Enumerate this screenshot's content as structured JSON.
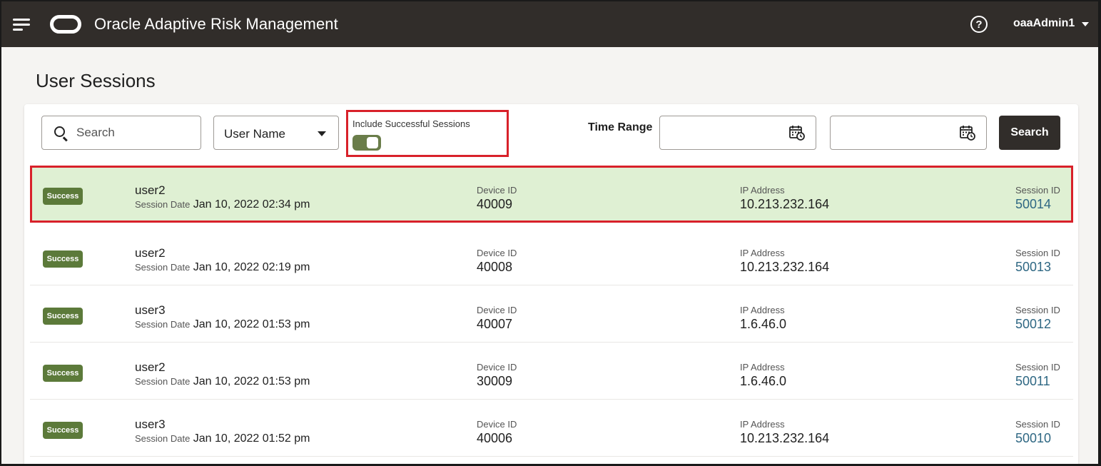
{
  "header": {
    "app_title": "Oracle Adaptive Risk Management",
    "user": "oaaAdmin1",
    "icons": [
      "hamburger-menu-icon",
      "oracle-logo",
      "help-icon",
      "caret-down-icon"
    ]
  },
  "page": {
    "title": "User Sessions"
  },
  "filters": {
    "search_placeholder": "Search",
    "search_value": "",
    "field_select": "User Name",
    "toggle_label": "Include Successful Sessions",
    "toggle_on": true,
    "time_range_label": "Time Range",
    "from_date": "",
    "to_date": "",
    "search_button": "Search"
  },
  "columns": {
    "session_date": "Session Date",
    "device_id": "Device ID",
    "ip_address": "IP Address",
    "session_id": "Session ID"
  },
  "sessions": [
    {
      "status": "Success",
      "user": "user2",
      "date": "Jan 10, 2022 02:34 pm",
      "device_id": "40009",
      "ip": "10.213.232.164",
      "session_id": "50014"
    },
    {
      "status": "Success",
      "user": "user2",
      "date": "Jan 10, 2022 02:19 pm",
      "device_id": "40008",
      "ip": "10.213.232.164",
      "session_id": "50013"
    },
    {
      "status": "Success",
      "user": "user3",
      "date": "Jan 10, 2022 01:53 pm",
      "device_id": "40007",
      "ip": "1.6.46.0",
      "session_id": "50012"
    },
    {
      "status": "Success",
      "user": "user2",
      "date": "Jan 10, 2022 01:53 pm",
      "device_id": "30009",
      "ip": "1.6.46.0",
      "session_id": "50011"
    },
    {
      "status": "Success",
      "user": "user3",
      "date": "Jan 10, 2022 01:52 pm",
      "device_id": "40006",
      "ip": "10.213.232.164",
      "session_id": "50010"
    }
  ],
  "colors": {
    "header_bg": "#312d2a",
    "success_badge": "#5c7a3a",
    "selected_row": "#dff0d3",
    "highlight": "#d8212a",
    "link": "#2e6783"
  }
}
